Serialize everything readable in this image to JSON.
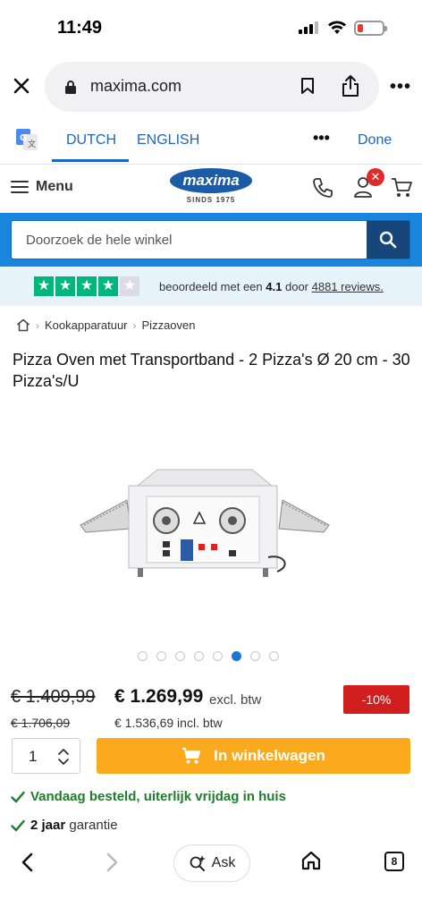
{
  "status": {
    "time": "11:49"
  },
  "browser": {
    "url": "maxima.com"
  },
  "translate": {
    "lang_from": "DUTCH",
    "lang_to": "ENGLISH",
    "more": "•••",
    "done": "Done"
  },
  "header": {
    "menu_label": "Menu",
    "logo_text": "maxima",
    "logo_sub": "SINDS 1975",
    "notification_badge": "✕"
  },
  "search": {
    "placeholder": "Doorzoek de hele winkel"
  },
  "rating": {
    "stars_filled": 4,
    "stars_total": 5,
    "prefix": "beoordeeld met een",
    "score": "4.1",
    "middle": "door",
    "reviews_link": "4881 reviews.",
    "star_color": "#00b67a"
  },
  "breadcrumb": {
    "items": [
      "Kookapparatuur",
      "Pizzaoven"
    ]
  },
  "product": {
    "title": "Pizza Oven met Transportband - 2 Pizza's Ø 20 cm - 30 Pizza's/U",
    "image_count": 8,
    "image_active_index": 5,
    "old_price_excl": "€ 1.409,99",
    "price_excl": "€ 1.269,99",
    "excl_label": "excl. btw",
    "discount": "-10%",
    "old_price_incl": "€ 1.706,09",
    "price_incl_text": "€ 1.536,69 incl. btw",
    "quantity": "1",
    "add_to_cart": "In winkelwagen",
    "delivery": "Vandaag besteld, uiterlijk vrijdag in huis",
    "warranty_bold": "2 jaar",
    "warranty_rest": "garantie"
  },
  "toolbar": {
    "ask_label": "Ask",
    "tab_count": "8"
  },
  "colors": {
    "brand_blue": "#1985dd",
    "cart_orange": "#fbaa1d",
    "discount_red": "#d11e1e",
    "accent_blue": "#1a66c9"
  }
}
